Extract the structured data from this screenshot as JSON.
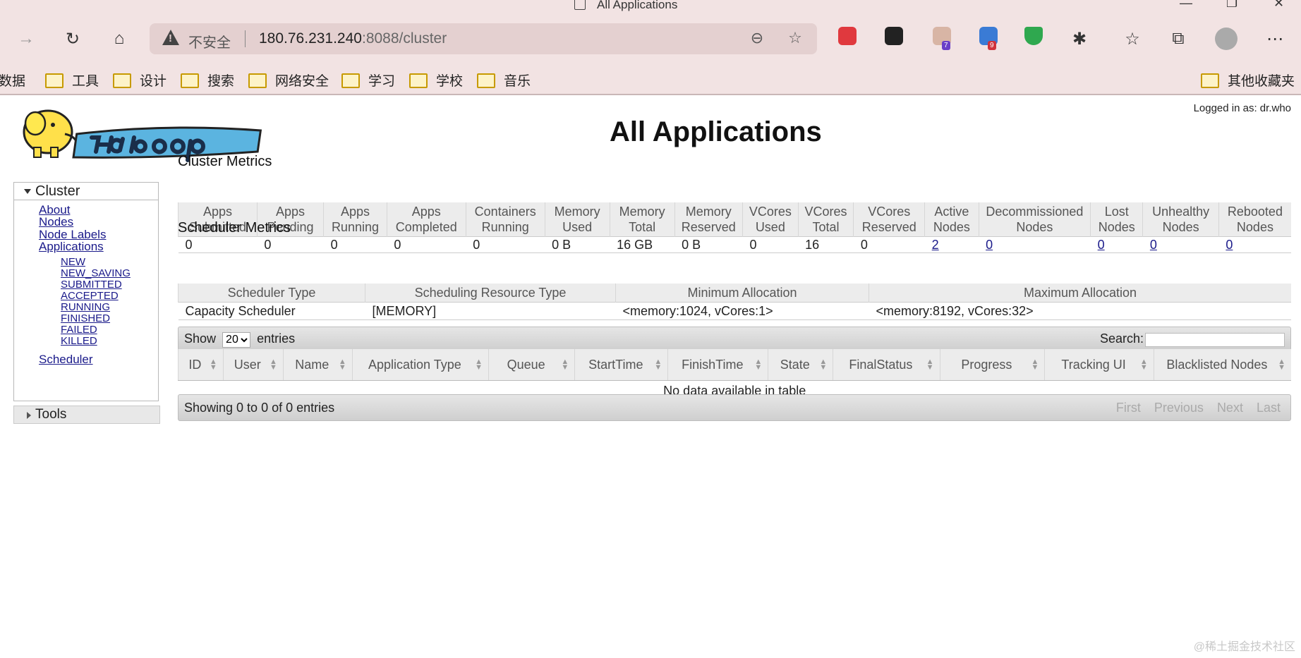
{
  "browser": {
    "tab_title": "All Applications",
    "insecure_label": "不安全",
    "url_host": "180.76.231.240",
    "url_path": ":8088/cluster",
    "badges": [
      "7",
      "9"
    ],
    "bookmarks": [
      "数据",
      "工具",
      "设计",
      "搜索",
      "网络安全",
      "学习",
      "学校",
      "音乐"
    ],
    "other_bookmarks": "其他收藏夹"
  },
  "page": {
    "logged_in": "Logged in as: dr.who",
    "title": "All Applications"
  },
  "nav": {
    "cluster": "Cluster",
    "items": [
      "About",
      "Nodes",
      "Node Labels",
      "Applications"
    ],
    "states": [
      "NEW",
      "NEW_SAVING",
      "SUBMITTED",
      "ACCEPTED",
      "RUNNING",
      "FINISHED",
      "FAILED",
      "KILLED"
    ],
    "scheduler": "Scheduler",
    "tools": "Tools"
  },
  "cluster_metrics": {
    "title": "Cluster Metrics",
    "headers": [
      [
        "Apps",
        "Submitted"
      ],
      [
        "Apps",
        "Pending"
      ],
      [
        "Apps",
        "Running"
      ],
      [
        "Apps",
        "Completed"
      ],
      [
        "Containers",
        "Running"
      ],
      [
        "Memory",
        "Used"
      ],
      [
        "Memory",
        "Total"
      ],
      [
        "Memory",
        "Reserved"
      ],
      [
        "VCores",
        "Used"
      ],
      [
        "VCores",
        "Total"
      ],
      [
        "VCores",
        "Reserved"
      ],
      [
        "Active",
        "Nodes"
      ],
      [
        "Decommissioned",
        "Nodes"
      ],
      [
        "Lost",
        "Nodes"
      ],
      [
        "Unhealthy",
        "Nodes"
      ],
      [
        "Rebooted",
        "Nodes"
      ]
    ],
    "values": [
      "0",
      "0",
      "0",
      "0",
      "0",
      "0 B",
      "16 GB",
      "0 B",
      "0",
      "16",
      "0",
      "2",
      "0",
      "0",
      "0",
      "0"
    ]
  },
  "scheduler_metrics": {
    "title": "Scheduler Metrics",
    "headers": [
      "Scheduler Type",
      "Scheduling Resource Type",
      "Minimum Allocation",
      "Maximum Allocation"
    ],
    "values": [
      "Capacity Scheduler",
      "[MEMORY]",
      "<memory:1024, vCores:1>",
      "<memory:8192, vCores:32>"
    ]
  },
  "apps_table": {
    "show_label": "Show",
    "page_size": "20",
    "entries_label": "entries",
    "search_label": "Search:",
    "columns": [
      "ID",
      "User",
      "Name",
      "Application Type",
      "Queue",
      "StartTime",
      "FinishTime",
      "State",
      "FinalStatus",
      "Progress",
      "Tracking UI",
      "Blacklisted Nodes"
    ],
    "empty": "No data available in table",
    "info": "Showing 0 to 0 of 0 entries",
    "pager": [
      "First",
      "Previous",
      "Next",
      "Last"
    ]
  },
  "watermark": "@稀土掘金技术社区",
  "colors": {
    "chrome": "#f2e3e3",
    "link": "#1a1a8a",
    "header_bg": "#ececec"
  }
}
